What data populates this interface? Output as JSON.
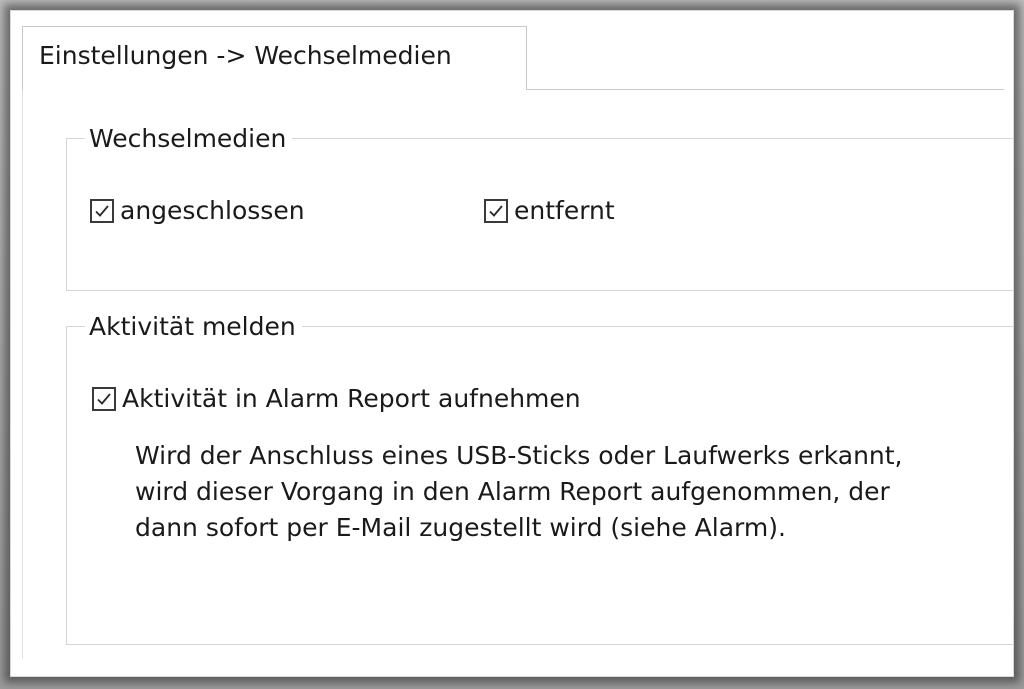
{
  "tab": {
    "label": "Einstellungen -> Wechselmedien"
  },
  "groups": {
    "wechselmedien": {
      "title": "Wechselmedien",
      "checkboxes": [
        {
          "label": "angeschlossen",
          "checked": true
        },
        {
          "label": "entfernt",
          "checked": true
        }
      ]
    },
    "aktivitaet": {
      "title": "Aktivität melden",
      "checkbox": {
        "label": "Aktivität in Alarm Report aufnehmen",
        "checked": true
      },
      "description_lines": [
        "Wird der Anschluss eines USB-Sticks oder Laufwerks erkannt,",
        "wird dieser Vorgang in den Alarm Report aufgenommen, der",
        "dann sofort per E-Mail zugestellt wird (siehe Alarm)."
      ]
    }
  },
  "colors": {
    "text": "#1a1a1a",
    "border": "#d5d5d5",
    "checkbox_border": "#3a3a3a",
    "background": "#ffffff"
  },
  "icons": {
    "checkmark": "checkmark-icon"
  }
}
